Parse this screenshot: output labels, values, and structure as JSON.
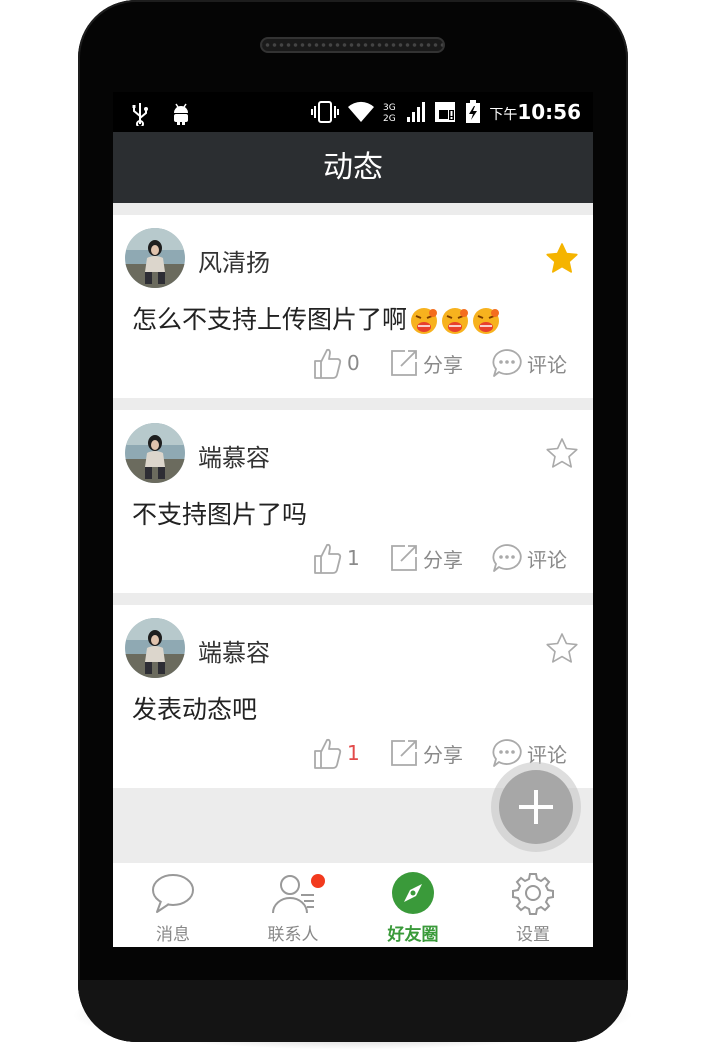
{
  "status_bar": {
    "time_prefix": "下午",
    "time": "10:56",
    "network": "3G\n2G",
    "icons": [
      "usb-icon",
      "android-debug-icon",
      "vibrate-icon",
      "wifi-icon",
      "signal-icon",
      "sim-icon",
      "battery-icon"
    ]
  },
  "header": {
    "title": "动态"
  },
  "posts": [
    {
      "username": "风清扬",
      "content": "怎么不支持上传图片了啊",
      "emojis": 3,
      "starred": true,
      "likes": "0",
      "likes_highlight": false,
      "share_label": "分享",
      "comment_label": "评论"
    },
    {
      "username": "端慕容",
      "content": "不支持图片了吗",
      "emojis": 0,
      "starred": false,
      "likes": "1",
      "likes_highlight": false,
      "share_label": "分享",
      "comment_label": "评论"
    },
    {
      "username": "端慕容",
      "content": "发表动态吧",
      "emojis": 0,
      "starred": false,
      "likes": "1",
      "likes_highlight": true,
      "share_label": "分享",
      "comment_label": "评论"
    }
  ],
  "tabs": [
    {
      "label": "消息",
      "icon": "chat-bubble-icon",
      "active": false
    },
    {
      "label": "联系人",
      "icon": "contacts-icon",
      "active": false,
      "badge": true
    },
    {
      "label": "好友圈",
      "icon": "compass-icon",
      "active": true
    },
    {
      "label": "设置",
      "icon": "gear-icon",
      "active": false
    }
  ],
  "colors": {
    "title_bar": "#2b2e31",
    "star_active": "#f5b400",
    "tab_active": "#3a9a3a",
    "badge": "#f23a1e",
    "like_highlight": "#e24a4a"
  }
}
